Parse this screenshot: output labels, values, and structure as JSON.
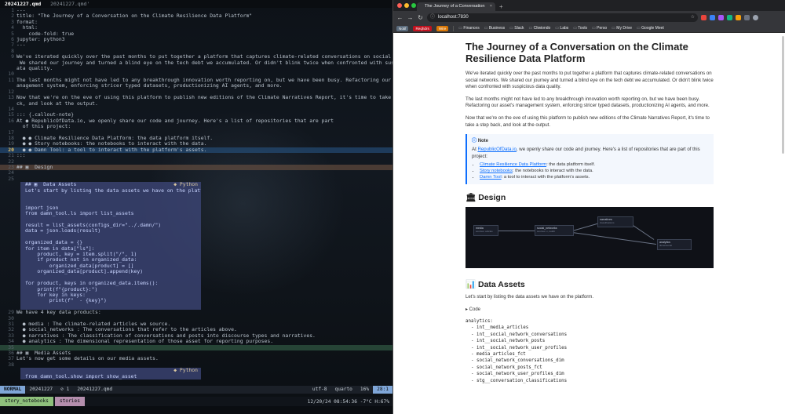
{
  "editor": {
    "tabs": [
      {
        "label": "20241227.qmd",
        "active": true
      },
      {
        "label": "20241227.qmd'",
        "active": false
      }
    ],
    "lines": [
      {
        "n": "1",
        "t": "---"
      },
      {
        "n": "2",
        "t": "title: \"The Journey of a Conversation on the Climate Resilience Data Platform\""
      },
      {
        "n": "3",
        "t": "format:"
      },
      {
        "n": "4",
        "t": "  html:"
      },
      {
        "n": "5",
        "t": "    code-fold: true"
      },
      {
        "n": "6",
        "t": "jupyter: python3"
      },
      {
        "n": "7",
        "t": "---"
      },
      {
        "n": "8",
        "t": ""
      },
      {
        "n": "9",
        "t": "We've iterated quickly over the past months to put together a platform that captures climate-related conversations on social networks."
      },
      {
        "n": "",
        "t": " We shared our journey and turned a blind eye on the tech debt we accumulated. Or didn't blink twice when confronted with suspicious d"
      },
      {
        "n": "",
        "t": "ata quality."
      },
      {
        "n": "10",
        "t": ""
      },
      {
        "n": "11",
        "t": "The last months might not have led to any breakthrough innovation worth reporting on, but we have been busy. Refactoring our asset's m"
      },
      {
        "n": "",
        "t": "anagement system, enforcing stricer typed datasets, productionizing AI agents, and more."
      },
      {
        "n": "12",
        "t": ""
      },
      {
        "n": "13",
        "t": "Now that we're on the eve of using this platform to publish new editions of the Climate Narratives Report, it's time to take a step ba"
      },
      {
        "n": "",
        "t": "ck, and look at the output."
      },
      {
        "n": "14",
        "t": ""
      },
      {
        "n": "15",
        "t": "::: {.callout-note}"
      },
      {
        "n": "16",
        "t": "At ● RepublicOfData.io, we openly share our code and journey. Here's a list of repositories that are part"
      },
      {
        "n": "",
        "t": "  of this project:"
      },
      {
        "n": "17",
        "t": ""
      },
      {
        "n": "18",
        "t": "  ● ● Climate Resilience Data Platform: the data platform itself."
      },
      {
        "n": "19",
        "t": "  ● ● Story notebooks: the notebooks to interact with the data."
      },
      {
        "n": "20",
        "t": "  ● ● Damn Tool: a tool to interact with the platform's assets."
      },
      {
        "n": "21",
        "t": ":::"
      },
      {
        "n": "22",
        "t": ""
      },
      {
        "n": "23",
        "t": "## ▣  Design"
      },
      {
        "n": "24",
        "t": ""
      },
      {
        "n": "25",
        "t": ""
      },
      {
        "n": "26",
        "t": "## ▣  Data Assets"
      },
      {
        "n": "27",
        "t": "Let's start by listing the data assets we have on the platform."
      },
      {
        "n": "28",
        "t": ""
      },
      {
        "n": "29",
        "t": ""
      },
      {
        "n": "",
        "t": "import json"
      },
      {
        "n": "",
        "t": "from damn_tool.ls import list_assets"
      },
      {
        "n": "",
        "t": ""
      },
      {
        "n": "",
        "t": "result = list_assets(configs_dir=\"../.damn/\")"
      },
      {
        "n": "",
        "t": "data = json.loads(result)"
      },
      {
        "n": "",
        "t": ""
      },
      {
        "n": "",
        "t": "organized_data = {}"
      },
      {
        "n": "",
        "t": "for item in data[\"ls\"]:"
      },
      {
        "n": "",
        "t": "    product, key = item.split(\"/\", 1)"
      },
      {
        "n": "",
        "t": "    if product not in organized_data:"
      },
      {
        "n": "",
        "t": "        organized_data[product] = []"
      },
      {
        "n": "",
        "t": "    organized_data[product].append(key)"
      },
      {
        "n": "",
        "t": ""
      },
      {
        "n": "",
        "t": "for product, keys in organized_data.items():"
      },
      {
        "n": "",
        "t": "    print(f\"{product}:\")"
      },
      {
        "n": "",
        "t": "    for key in keys:"
      },
      {
        "n": "",
        "t": "        print(f\"  - {key}\")"
      },
      {
        "n": "",
        "t": ""
      },
      {
        "n": "29",
        "t": "We have 4 key data products:"
      },
      {
        "n": "30",
        "t": ""
      },
      {
        "n": "31",
        "t": "  ● media : The climate-related articles we source."
      },
      {
        "n": "32",
        "t": "  ● social_networks : The conversations that refer to the articles above."
      },
      {
        "n": "33",
        "t": "  ● narratives : The classification of conversations and posts into discourse types and narratives."
      },
      {
        "n": "34",
        "t": "  ● analytics : The dimensional representation of those asset for reporting purposes."
      },
      {
        "n": "35",
        "t": ""
      },
      {
        "n": "36",
        "t": "## ▣  Media Assets"
      },
      {
        "n": "37",
        "t": "Let's now get some details on our media assets."
      },
      {
        "n": "38",
        "t": ""
      },
      {
        "n": "39",
        "t": ""
      },
      {
        "n": "",
        "t": "from damn_tool.show import show_asset"
      }
    ],
    "python_label_1": "◆ Python",
    "python_label_2": "◆ Python",
    "status": {
      "mode": "NORMAL",
      "branch": " 20241227",
      "diag": "⊘ 1",
      "file": "20241227.qmd",
      "encoding": "utf-8",
      "ft": "quarto",
      "percent": "16%",
      "pos": "28:1"
    },
    "tmux": {
      "win1": "story_notebooks",
      "win2": "stories",
      "clock": "12/20/24 08:54:36",
      "weather": "-7°C H:67%"
    }
  },
  "browser": {
    "tab_title": "The Journey of a Conversation",
    "url": "localhost:7830",
    "bookmark_pills": [
      {
        "label": "Notif",
        "color": "#5a6b7c"
      },
      {
        "label": "Reqhdrs",
        "color": "#c1121f"
      },
      {
        "label": "Wire",
        "color": "#d97706"
      }
    ],
    "bookmarks": [
      "Finances",
      "Business",
      "Slack",
      "Cliwiondo",
      "Labs",
      "Tools",
      "Perso",
      "My Drive",
      "Google Meet"
    ],
    "page": {
      "title": "The Journey of a Conversation on the Climate Resilience Data Platform",
      "p1": "We've iterated quickly over the past months to put together a platform that captures climate-related conversations on social networks. We shared our journey and turned a blind eye on the tech debt we accumulated. Or didn't blink twice when confronted with suspicious data quality.",
      "p2": "The last months might not have led to any breakthrough innovation worth reporting on, but we have been busy. Refactoring our asset's management system, enforcing stricer typed datasets, productionizing AI agents, and more.",
      "p3": "Now that we're on the eve of using this platform to publish new editions of the Climate Narratives Report, it's time to take a step back, and look at the output.",
      "note_label": "Note",
      "note_intro_pre": "At ",
      "note_intro_link": "RepublicOfData.io",
      "note_intro_post": ", we openly share our code and journey. Here's a list of repositories that are part of this project:",
      "repos": [
        {
          "link": "Climate Resilience Data Platform",
          "desc": ": the data platform itself."
        },
        {
          "link": "Story notebooks",
          "desc": ": the notebooks to interact with the data."
        },
        {
          "link": "Damn Tool",
          "desc": ": a tool to interact with the platform's assets."
        }
      ],
      "design_heading": "🏛 Design",
      "data_assets_heading": "📊 Data Assets",
      "data_assets_intro": "Let's start by listing the data assets we have on the platform.",
      "code_toggle": "▸ Code",
      "output": "analytics:\n  - int__media_articles\n  - int__social_network_conversations\n  - int__social_network_posts\n  - int__social_network_user_profiles\n  - media_articles_fct\n  - social_network_conversations_dim\n  - social_network_posts_fct\n  - social_network_user_profiles_dim\n  - stg__conversation_classifications",
      "diagram_nodes": [
        {
          "label": "media",
          "sub": "sources: articles"
        },
        {
          "label": "social_networks",
          "sub": "sources: x, reddit"
        },
        {
          "label": "narratives",
          "sub": "classifications"
        },
        {
          "label": "analytics",
          "sub": "dimensional"
        }
      ]
    }
  }
}
